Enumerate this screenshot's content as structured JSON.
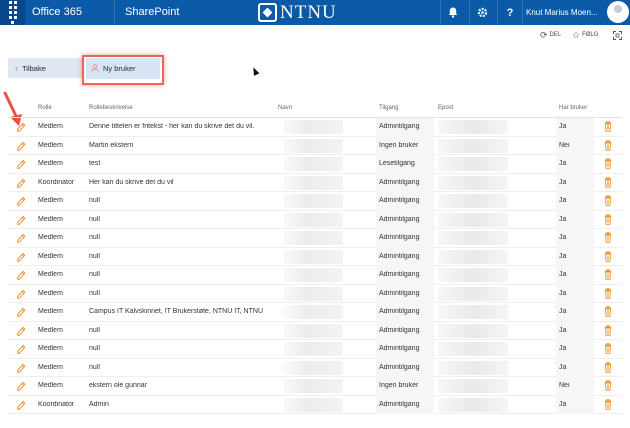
{
  "suite": {
    "office_label": "Office 365",
    "sharepoint_label": "SharePoint",
    "logo_text": "NTNU",
    "user_name": "Knut Marius Moen..."
  },
  "commands": {
    "share_label": "DEL",
    "follow_label": "FØLG"
  },
  "toolbar": {
    "back_label": "Tilbake",
    "new_user_label": "Ny bruker"
  },
  "table": {
    "headers": {
      "rolle": "Rolle",
      "beskrivelse": "Rollebeskrivelse",
      "navn": "Navn",
      "tilgang": "Tilgang",
      "epost": "Epost",
      "har_bruker": "Har bruker"
    },
    "rows": [
      {
        "rolle": "Medlem",
        "beskrivelse": "Denne tittelen er fritekst - her kan du skrive det du vil.",
        "tilgang": "Admintilgang",
        "har_bruker": "Ja"
      },
      {
        "rolle": "Medlem",
        "beskrivelse": "Martin ekstern",
        "tilgang": "Ingen bruker",
        "har_bruker": "Nei"
      },
      {
        "rolle": "Medlem",
        "beskrivelse": "test",
        "tilgang": "Lesetilgang",
        "har_bruker": "Ja"
      },
      {
        "rolle": "Koordinator",
        "beskrivelse": "Her kan du skrive det du vil",
        "tilgang": "Admintilgang",
        "har_bruker": "Ja"
      },
      {
        "rolle": "Medlem",
        "beskrivelse": "null",
        "tilgang": "Admintilgang",
        "har_bruker": "Ja"
      },
      {
        "rolle": "Medlem",
        "beskrivelse": "null",
        "tilgang": "Admintilgang",
        "har_bruker": "Ja"
      },
      {
        "rolle": "Medlem",
        "beskrivelse": "null",
        "tilgang": "Admintilgang",
        "har_bruker": "Ja"
      },
      {
        "rolle": "Medlem",
        "beskrivelse": "null",
        "tilgang": "Admintilgang",
        "har_bruker": "Ja"
      },
      {
        "rolle": "Medlem",
        "beskrivelse": "null",
        "tilgang": "Admintilgang",
        "har_bruker": "Ja"
      },
      {
        "rolle": "Medlem",
        "beskrivelse": "null",
        "tilgang": "Admintilgang",
        "har_bruker": "Ja"
      },
      {
        "rolle": "Medlem",
        "beskrivelse": "Campus IT Kalvskinnet, IT Brukerstøte, NTNU IT, NTNU",
        "tilgang": "Admintilgang",
        "har_bruker": "Ja"
      },
      {
        "rolle": "Medlem",
        "beskrivelse": "null",
        "tilgang": "Admintilgang",
        "har_bruker": "Ja"
      },
      {
        "rolle": "Medlem",
        "beskrivelse": "null",
        "tilgang": "Admintilgang",
        "har_bruker": "Ja"
      },
      {
        "rolle": "Medlem",
        "beskrivelse": "null",
        "tilgang": "Admintilgang",
        "har_bruker": "Ja"
      },
      {
        "rolle": "Medlem",
        "beskrivelse": "ekstern ole gunnar",
        "tilgang": "Ingen bruker",
        "har_bruker": "Nei"
      },
      {
        "rolle": "Koordinator",
        "beskrivelse": "Admin",
        "tilgang": "Admintilgang",
        "har_bruker": "Ja"
      }
    ]
  },
  "colors": {
    "suite_bar": "#0b5aa8",
    "highlight": "#e8665a",
    "edit_icon": "#e8942f",
    "delete_icon": "#e8942f"
  },
  "icons": [
    "waffle-icon",
    "bell-icon",
    "gear-icon",
    "help-icon",
    "sync-icon",
    "star-icon",
    "focus-icon",
    "chevron-left-icon",
    "person-icon",
    "pencil-icon",
    "trash-icon",
    "arrow-icon"
  ]
}
